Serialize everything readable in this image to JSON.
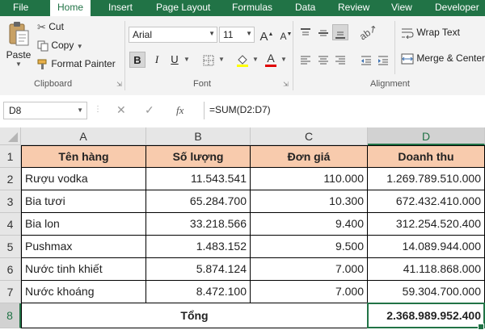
{
  "tabs": [
    "File",
    "Home",
    "Insert",
    "Page Layout",
    "Formulas",
    "Data",
    "Review",
    "View",
    "Developer"
  ],
  "active_tab": "Home",
  "clipboard": {
    "paste_label": "Paste",
    "cut_label": "Cut",
    "copy_label": "Copy",
    "format_painter_label": "Format Painter",
    "group_label": "Clipboard"
  },
  "font": {
    "name": "Arial",
    "size": "11",
    "group_label": "Font"
  },
  "alignment": {
    "wrap_text_label": "Wrap Text",
    "merge_center_label": "Merge & Center",
    "group_label": "Alignment"
  },
  "formula_bar": {
    "name_box": "D8",
    "fx_label": "fx",
    "formula": "=SUM(D2:D7)"
  },
  "grid": {
    "columns": [
      "A",
      "B",
      "C",
      "D"
    ],
    "selected_column": "D",
    "rows": [
      "1",
      "2",
      "3",
      "4",
      "5",
      "6",
      "7",
      "8"
    ],
    "selected_row": "8",
    "header": [
      "Tên hàng",
      "Số lượng",
      "Đơn giá",
      "Doanh thu"
    ],
    "data": [
      [
        "Rượu vodka",
        "11.543.541",
        "110.000",
        "1.269.789.510.000"
      ],
      [
        "Bia tươi",
        "65.284.700",
        "10.300",
        "672.432.410.000"
      ],
      [
        "Bia lon",
        "33.218.566",
        "9.400",
        "312.254.520.400"
      ],
      [
        "Pushmax",
        "1.483.152",
        "9.500",
        "14.089.944.000"
      ],
      [
        "Nước tinh khiết",
        "5.874.124",
        "7.000",
        "41.118.868.000"
      ],
      [
        "Nước khoáng",
        "8.472.100",
        "7.000",
        "59.304.700.000"
      ]
    ],
    "total_label": "Tổng",
    "total_value": "2.368.989.952.400"
  },
  "colors": {
    "accent": "#217346",
    "header_fill": "#f8cbad"
  }
}
